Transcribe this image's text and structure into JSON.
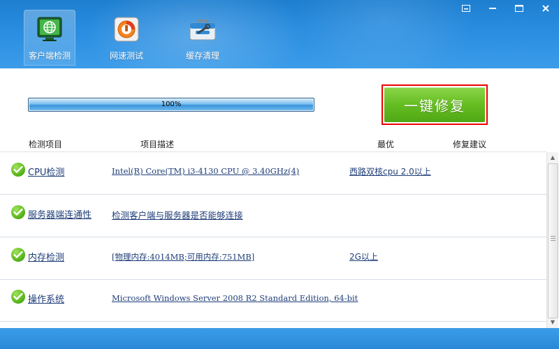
{
  "header": {
    "tabs": [
      {
        "label": "客户端检测",
        "icon": "monitor-globe-icon",
        "active": true
      },
      {
        "label": "网速测试",
        "icon": "speed-gauge-icon",
        "active": false
      },
      {
        "label": "缓存清理",
        "icon": "toolbox-icon",
        "active": false
      }
    ],
    "window_buttons": [
      "menu-icon",
      "minimize-icon",
      "maximize-icon",
      "close-icon"
    ]
  },
  "progress": {
    "value": 1.0,
    "text": "100%"
  },
  "repair_button": {
    "label": "一键修复"
  },
  "table": {
    "columns": [
      "检测项目",
      "项目描述",
      "最优",
      "修复建议"
    ],
    "rows": [
      {
        "item": "CPU检测",
        "desc": "Intel(R) Core(TM) i3-4130 CPU @ 3.40GHz(4)",
        "best": "西路双核cpu 2.0以上",
        "status": "ok"
      },
      {
        "item": "服务器端连通性",
        "desc": "检测客户端与服务器是否能够连接",
        "best": "",
        "status": "ok"
      },
      {
        "item": "内存检测",
        "desc": "[物理内存:4014MB;可用内存:751MB]",
        "best": "2G以上",
        "status": "ok"
      },
      {
        "item": "操作系统",
        "desc": "Microsoft Windows Server 2008 R2 Standard Edition, 64-bit",
        "best": "",
        "status": "ok"
      }
    ]
  },
  "colors": {
    "header": "#2a8de0",
    "accent_green": "#65bd22",
    "highlight_border": "#ee0000"
  }
}
